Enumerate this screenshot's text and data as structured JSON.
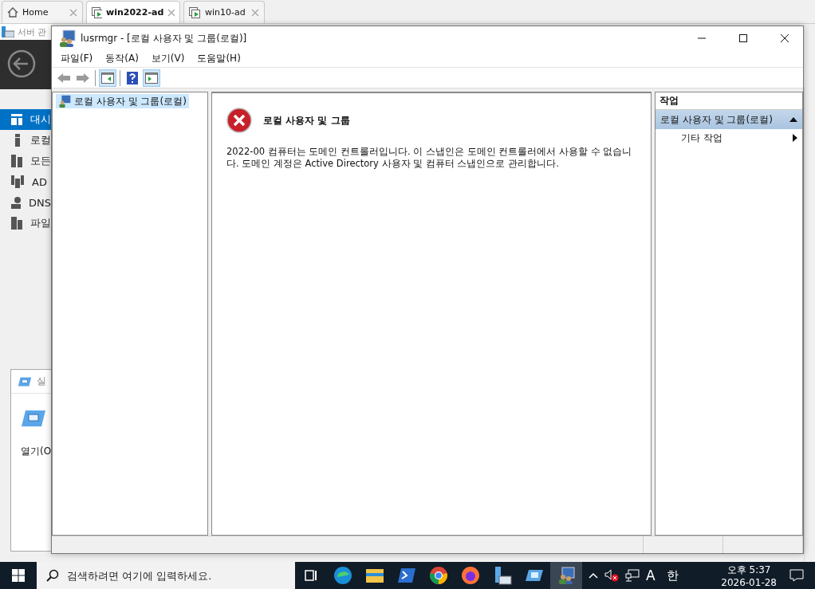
{
  "vm_tabs": [
    {
      "label": "Home",
      "kind": "home",
      "selected": false
    },
    {
      "label": "win2022-ad",
      "kind": "vm",
      "selected": true
    },
    {
      "label": "win10-ad",
      "kind": "vm",
      "selected": false
    }
  ],
  "background_app": {
    "title": "서버 관",
    "nav_items": [
      {
        "label": "대시",
        "kind": "dashboard",
        "selected": true
      },
      {
        "label": "로컬",
        "kind": "local",
        "selected": false
      },
      {
        "label": "모든",
        "kind": "all",
        "selected": false
      },
      {
        "label": "AD",
        "kind": "ad",
        "selected": false
      },
      {
        "label": "DNS",
        "kind": "dns",
        "selected": false
      },
      {
        "label": "파일",
        "kind": "files",
        "selected": false
      }
    ],
    "panel": {
      "title": "실",
      "open_label": "열기(O"
    }
  },
  "window": {
    "title": "lusrmgr - [로컬 사용자 및 그룹(로컬)]",
    "menu": [
      "파일(F)",
      "동작(A)",
      "보기(V)",
      "도움말(H)"
    ],
    "toolbar": [
      {
        "kind": "back",
        "pressed": false
      },
      {
        "kind": "forward",
        "pressed": false
      },
      {
        "kind": "tree",
        "pressed": true
      },
      {
        "kind": "help",
        "pressed": false
      },
      {
        "kind": "actionpane",
        "pressed": true
      }
    ],
    "tree": [
      {
        "label": "로컬 사용자 및 그룹(로컬)",
        "selected": true
      }
    ],
    "content": {
      "heading": "로컬 사용자 및 그룹",
      "message": "2022-00 컴퓨터는 도메인 컨트롤러입니다. 이 스냅인은 도메인 컨트롤러에서 사용할 수 없습니다. 도메인 계정은 Active Directory 사용자 및 컴퓨터 스냅인으로 관리합니다."
    },
    "actions": {
      "header": "작업",
      "sections": [
        {
          "title": "로컬 사용자 및 그룹(로컬)",
          "expanded": true,
          "items": [
            {
              "label": "기타 작업",
              "submenu": true
            }
          ]
        }
      ]
    }
  },
  "taskbar": {
    "search_placeholder": "검색하려면 여기에 입력하세요.",
    "apps": [
      {
        "kind": "taskview",
        "active": false
      },
      {
        "kind": "edge",
        "active": false
      },
      {
        "kind": "explorer",
        "active": false
      },
      {
        "kind": "powershell",
        "active": false
      },
      {
        "kind": "chrome",
        "active": false
      },
      {
        "kind": "firefox",
        "active": false
      },
      {
        "kind": "servermanager",
        "active": false
      },
      {
        "kind": "remote",
        "active": false
      },
      {
        "kind": "users",
        "active": true
      }
    ],
    "ime_mode": "A",
    "ime_lang": "한",
    "time": "오후 5:37",
    "date": "2026-01-28"
  }
}
